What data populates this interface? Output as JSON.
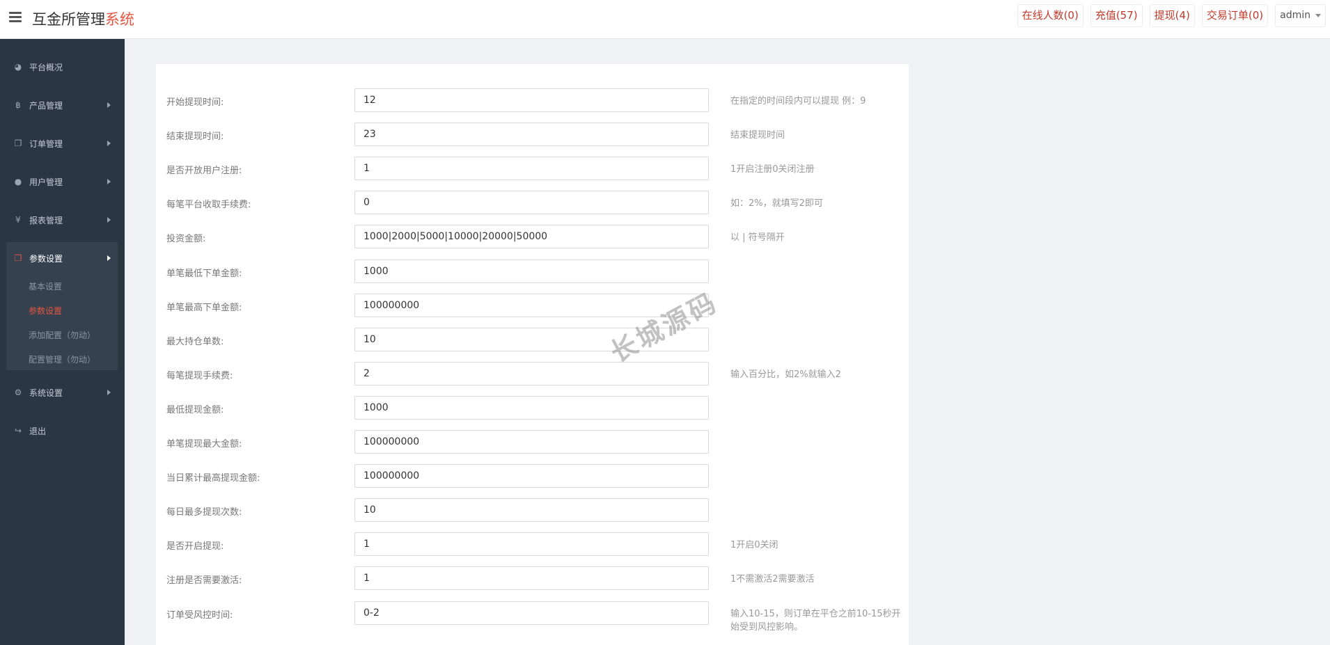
{
  "header": {
    "brand_main": "互金所管理",
    "brand_accent": "系统",
    "links": [
      {
        "label": "在线人数(0)"
      },
      {
        "label": "充值(57)"
      },
      {
        "label": "提现(4)"
      },
      {
        "label": "交易订单(0)"
      }
    ],
    "user": "admin"
  },
  "sidebar": {
    "items": [
      {
        "label": "平台概况",
        "icon": "dashboard-icon"
      },
      {
        "label": "产品管理",
        "icon": "bitcoin-icon"
      },
      {
        "label": "订单管理",
        "icon": "copy-icon"
      },
      {
        "label": "用户管理",
        "icon": "user-icon"
      },
      {
        "label": "报表管理",
        "icon": "yen-icon"
      },
      {
        "label": "参数设置",
        "icon": "copy-icon"
      },
      {
        "label": "系统设置",
        "icon": "gears-icon"
      },
      {
        "label": "退出",
        "icon": "sign-out-icon"
      }
    ],
    "sub_items": [
      {
        "label": "基本设置"
      },
      {
        "label": "参数设置"
      },
      {
        "label": "添加配置（勿动）"
      },
      {
        "label": "配置管理（勿动）"
      }
    ]
  },
  "form": {
    "rows": [
      {
        "label": "开始提现时间:",
        "value": "12",
        "hint": "在指定的时间段内可以提现 例：9"
      },
      {
        "label": "结束提现时间:",
        "value": "23",
        "hint": "结束提现时间"
      },
      {
        "label": "是否开放用户注册:",
        "value": "1",
        "hint": "1开启注册0关闭注册"
      },
      {
        "label": "每笔平台收取手续费:",
        "value": "0",
        "hint": "如：2%，就填写2即可"
      },
      {
        "label": "投资金额:",
        "value": "1000|2000|5000|10000|20000|50000",
        "hint": "以 | 符号隔开"
      },
      {
        "label": "单笔最低下单金额:",
        "value": "1000",
        "hint": ""
      },
      {
        "label": "单笔最高下单金额:",
        "value": "100000000",
        "hint": ""
      },
      {
        "label": "最大持仓单数:",
        "value": "10",
        "hint": ""
      },
      {
        "label": "每笔提现手续费:",
        "value": "2",
        "hint": "输入百分比，如2%就输入2"
      },
      {
        "label": "最低提现金额:",
        "value": "1000",
        "hint": ""
      },
      {
        "label": "单笔提现最大金额:",
        "value": "100000000",
        "hint": ""
      },
      {
        "label": "当日累计最高提现金额:",
        "value": "100000000",
        "hint": ""
      },
      {
        "label": "每日最多提现次数:",
        "value": "10",
        "hint": ""
      },
      {
        "label": "是否开启提现:",
        "value": "1",
        "hint": "1开启0关闭"
      },
      {
        "label": "注册是否需要激活:",
        "value": "1",
        "hint": "1不需激活2需要激活"
      },
      {
        "label": "订单受风控时间:",
        "value": "0-2",
        "hint": "输入10-15，则订单在平仓之前10-15秒开始受到风控影响。"
      }
    ]
  },
  "watermark": "长城源码"
}
